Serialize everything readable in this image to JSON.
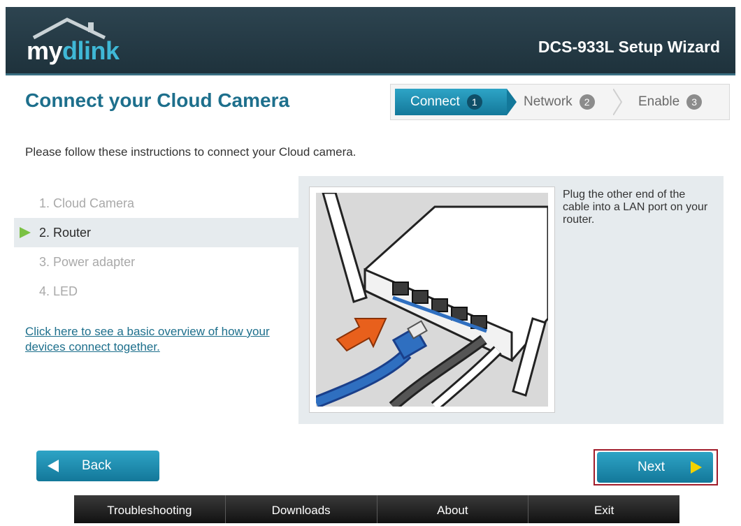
{
  "header": {
    "logo_prefix": "my",
    "logo_suffix": "dlink",
    "wizard_title": "DCS-933L Setup Wizard"
  },
  "page_title": "Connect your Cloud Camera",
  "steps": [
    {
      "label": "Connect",
      "number": "1",
      "active": true
    },
    {
      "label": "Network",
      "number": "2",
      "active": false
    },
    {
      "label": "Enable",
      "number": "3",
      "active": false
    }
  ],
  "instructions": "Please follow these instructions to connect your Cloud camera.",
  "list": [
    {
      "label": "1. Cloud Camera",
      "active": false
    },
    {
      "label": "2. Router",
      "active": true
    },
    {
      "label": "3. Power adapter",
      "active": false
    },
    {
      "label": "4. LED",
      "active": false
    }
  ],
  "overview_link": "Click here to see a basic overview of how your devices connect together.",
  "panel_text": "Plug the other end of the cable into a LAN port on your router.",
  "buttons": {
    "back": "Back",
    "next": "Next"
  },
  "footer": [
    "Troubleshooting",
    "Downloads",
    "About",
    "Exit"
  ],
  "colors": {
    "accent": "#1d6f8c",
    "button": "#1a8db2",
    "active_arrow": "#7ac143",
    "next_arrow": "#f2d200",
    "highlight_border": "#a01c2a"
  }
}
